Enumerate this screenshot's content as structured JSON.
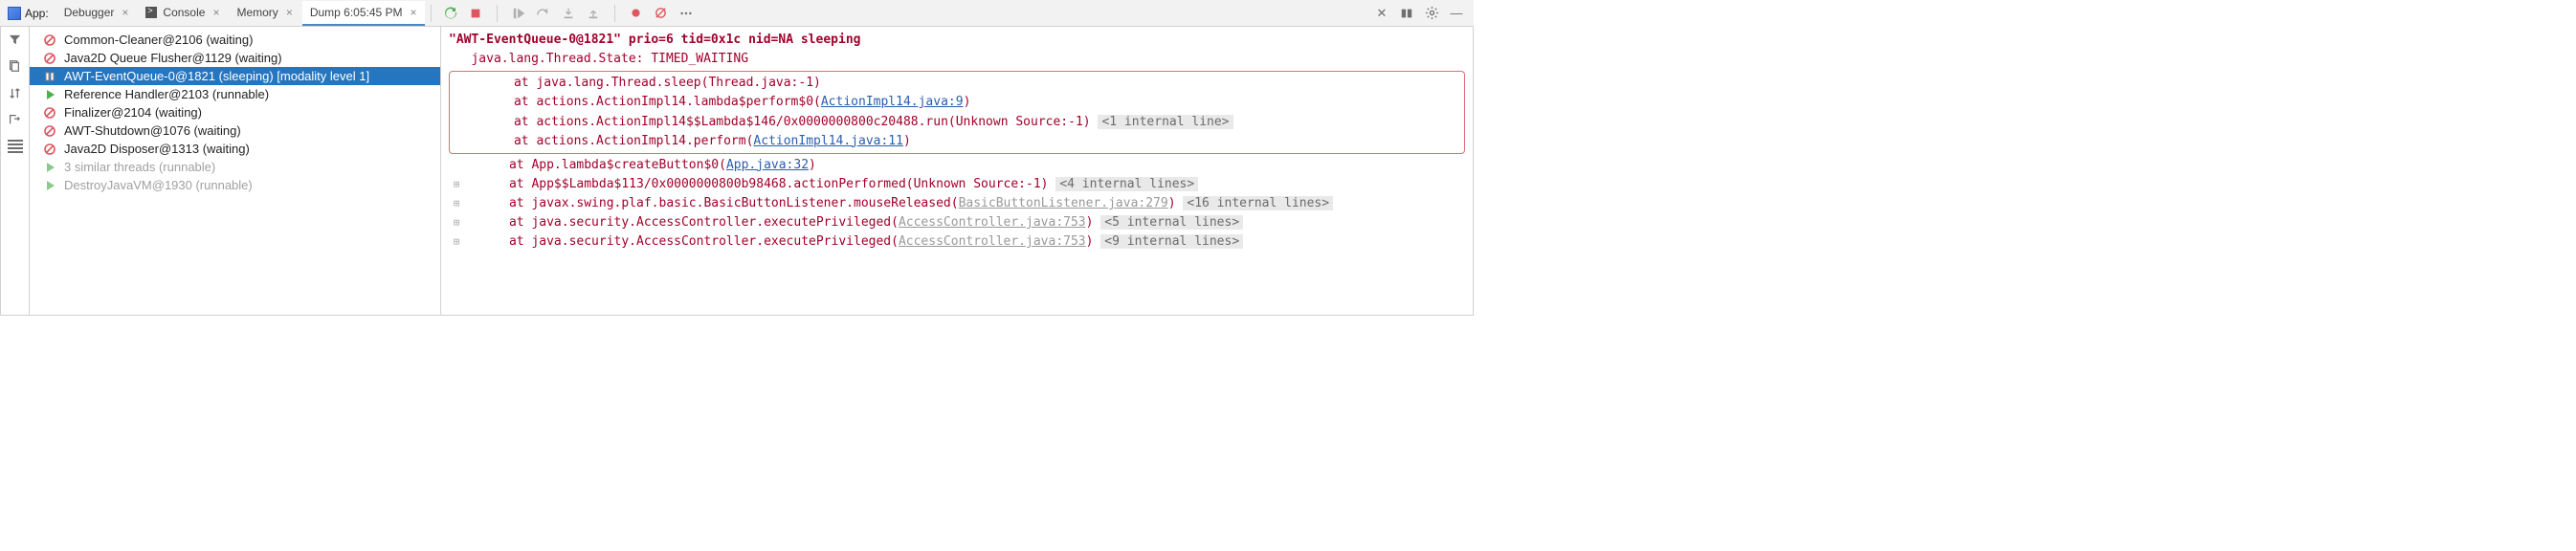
{
  "tabbar": {
    "app_label": "App:",
    "tabs": [
      {
        "label": "Debugger"
      },
      {
        "label": "Console"
      },
      {
        "label": "Memory"
      },
      {
        "label": "Dump 6:05:45 PM",
        "active": true
      }
    ]
  },
  "threads": [
    {
      "icon": "waiting",
      "label": "Common-Cleaner@2106 (waiting)"
    },
    {
      "icon": "waiting",
      "label": "Java2D Queue Flusher@1129 (waiting)"
    },
    {
      "icon": "sleeping",
      "label": "AWT-EventQueue-0@1821 (sleeping) [modality level 1]",
      "selected": true
    },
    {
      "icon": "runnable",
      "label": "Reference Handler@2103 (runnable)"
    },
    {
      "icon": "waiting",
      "label": "Finalizer@2104 (waiting)"
    },
    {
      "icon": "waiting",
      "label": "AWT-Shutdown@1076 (waiting)"
    },
    {
      "icon": "waiting",
      "label": "Java2D Disposer@1313 (waiting)"
    },
    {
      "icon": "runnable-muted",
      "label": "3 similar threads (runnable)",
      "muted": true
    },
    {
      "icon": "runnable-muted",
      "label": "DestroyJavaVM@1930 (runnable)",
      "muted": true
    }
  ],
  "stack": {
    "header": "\"AWT-EventQueue-0@1821\" prio=6 tid=0x1c nid=NA sleeping",
    "state": "   java.lang.Thread.State: TIMED_WAITING",
    "box": [
      {
        "pre": "      at java.lang.Thread.sleep(Thread.java:-1)"
      },
      {
        "pre": "      at actions.ActionImpl14.lambda$perform$0(",
        "link": "ActionImpl14.java:9",
        "post": ")"
      },
      {
        "pre": "      at actions.ActionImpl14$$Lambda$146/0x0000000800c20488.run(Unknown Source:-1) ",
        "gray": "<1 internal line>"
      },
      {
        "pre": "      at actions.ActionImpl14.perform(",
        "link": "ActionImpl14.java:11",
        "post": ")"
      }
    ],
    "rest": [
      {
        "expand": false,
        "pre": "      at App.lambda$createButton$0(",
        "link": "App.java:32",
        "post": ")"
      },
      {
        "expand": true,
        "pre": "      at App$$Lambda$113/0x0000000800b98468.actionPerformed(Unknown Source:-1) ",
        "gray": "<4 internal lines>"
      },
      {
        "expand": true,
        "pre": "      at javax.swing.plaf.basic.BasicButtonListener.mouseReleased(",
        "mlink": "BasicButtonListener.java:279",
        "post": ") ",
        "gray": "<16 internal lines>"
      },
      {
        "expand": true,
        "pre": "      at java.security.AccessController.executePrivileged(",
        "mlink": "AccessController.java:753",
        "post": ") ",
        "gray": "<5 internal lines>"
      },
      {
        "expand": true,
        "pre": "      at java.security.AccessController.executePrivileged(",
        "mlink": "AccessController.java:753",
        "post": ") ",
        "gray": "<9 internal lines>"
      }
    ]
  }
}
